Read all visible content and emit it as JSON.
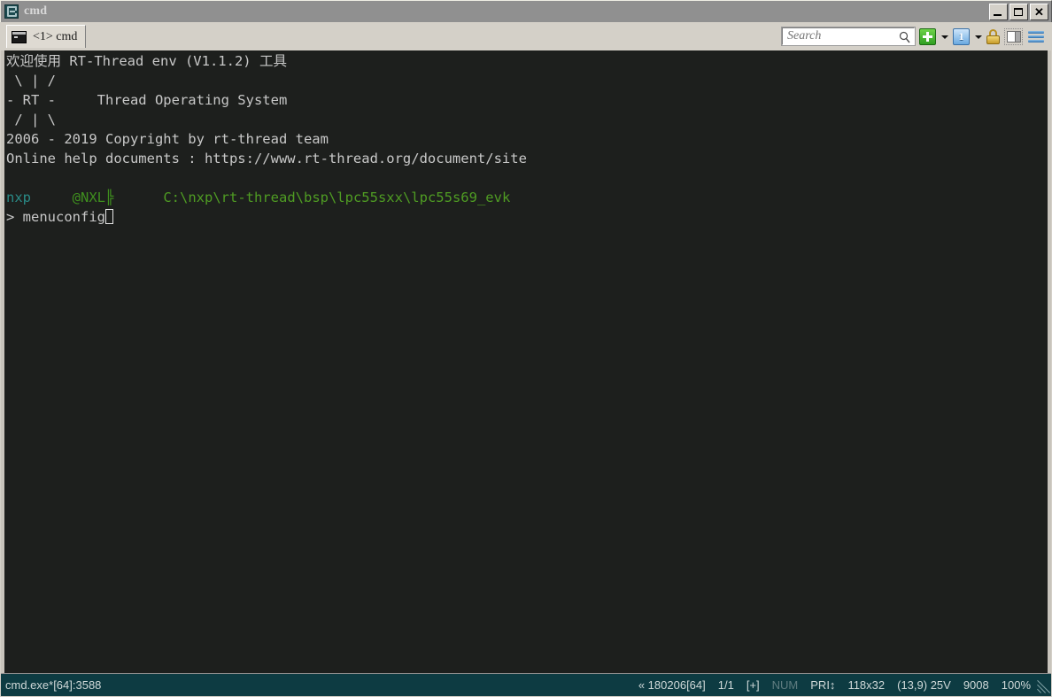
{
  "window": {
    "title": "cmd",
    "icon": "conemu-icon",
    "minimize_label": "_",
    "maximize_label": "",
    "close_label": "✕"
  },
  "tabs": [
    {
      "label": "<1> cmd",
      "icon": "console-icon",
      "active": true
    }
  ],
  "toolbar": {
    "search": {
      "placeholder": "Search",
      "value": "",
      "icon": "search-icon"
    },
    "new_console_label": "",
    "console_index_label": "1",
    "lock_icon": "lock-icon",
    "split_icon": "split-pane-icon",
    "menu_icon": "hamburger-menu-icon"
  },
  "terminal": {
    "lines": [
      {
        "segments": [
          {
            "text": "欢迎使用 RT-Thread env (V1.1.2) 工具",
            "style": "c-prompt"
          }
        ]
      },
      {
        "segments": [
          {
            "text": " \\ | /",
            "style": "c-prompt"
          }
        ]
      },
      {
        "segments": [
          {
            "text": "- RT -     Thread Operating System",
            "style": "c-prompt"
          }
        ]
      },
      {
        "segments": [
          {
            "text": " / | \\",
            "style": "c-prompt"
          }
        ]
      },
      {
        "segments": [
          {
            "text": "2006 - 2019 Copyright by rt-thread team",
            "style": "c-prompt"
          }
        ]
      },
      {
        "segments": [
          {
            "text": "Online help documents : https://www.rt-thread.org/document/site",
            "style": "c-prompt"
          }
        ]
      },
      {
        "segments": [
          {
            "text": "",
            "style": "c-prompt"
          }
        ]
      },
      {
        "segments": [
          {
            "text": "nxp",
            "style": "c-user"
          },
          {
            "text": "     ",
            "style": "c-prompt"
          },
          {
            "text": "@NXL╠",
            "style": "c-host"
          },
          {
            "text": "      ",
            "style": "c-prompt"
          },
          {
            "text": "C:\\nxp\\rt-thread\\bsp\\lpc55sxx\\lpc55s69_evk",
            "style": "c-path"
          }
        ]
      },
      {
        "segments": [
          {
            "text": "> menuconfig",
            "style": "c-prompt"
          },
          {
            "text": "",
            "style": "cursor"
          }
        ]
      }
    ],
    "cursor_after": "menuconfig",
    "background": "#1d1f1d",
    "foreground": "#c8c8c8"
  },
  "statusbar": {
    "process": "cmd.exe*[64]:3588",
    "items": [
      {
        "text": "« 180206[64]",
        "dim": false
      },
      {
        "text": "1/1",
        "dim": false
      },
      {
        "text": "[+]",
        "dim": false
      },
      {
        "text": "NUM",
        "dim": true
      },
      {
        "text": "PRI↕",
        "dim": false
      },
      {
        "text": "118x32",
        "dim": false
      },
      {
        "text": "(13,9) 25V",
        "dim": false
      },
      {
        "text": "9008",
        "dim": false
      },
      {
        "text": "100%",
        "dim": false
      }
    ],
    "grip": "resize-grip"
  },
  "colors": {
    "titlebar": "#909090",
    "chrome": "#d4d0c8",
    "status_bg": "#0d3b42",
    "terminal_bg": "#1d1f1d",
    "prompt_green": "#4f9c23",
    "prompt_teal": "#2a8a86"
  }
}
